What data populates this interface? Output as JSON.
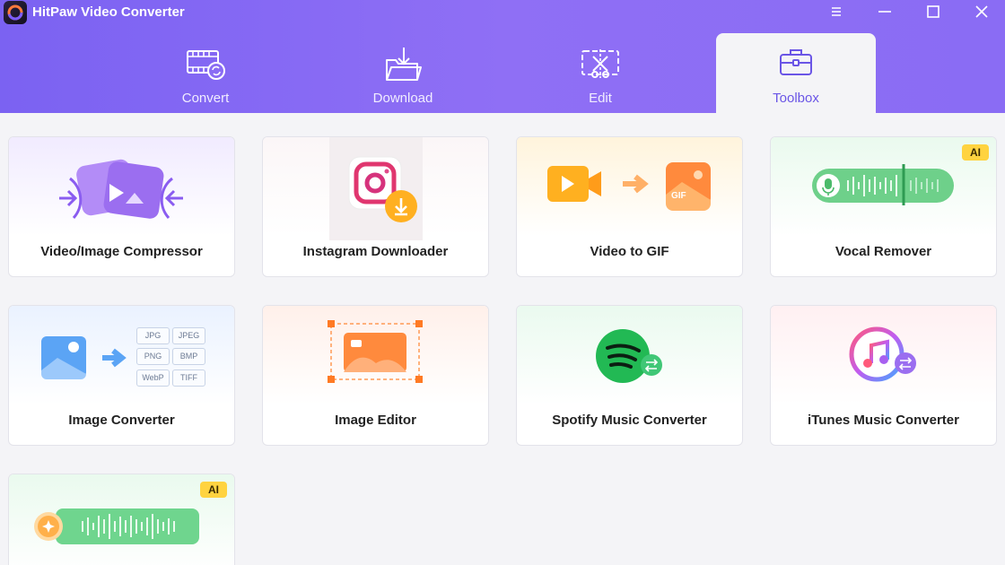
{
  "app": {
    "title": "HitPaw Video Converter"
  },
  "tabs": [
    {
      "label": "Convert",
      "icon": "convert-film-icon",
      "active": false
    },
    {
      "label": "Download",
      "icon": "download-folder-icon",
      "active": false
    },
    {
      "label": "Edit",
      "icon": "edit-scissors-icon",
      "active": false
    },
    {
      "label": "Toolbox",
      "icon": "toolbox-icon",
      "active": true
    }
  ],
  "tools": [
    {
      "label": "Video/Image Compressor",
      "icon": "compressor-icon",
      "ai": false
    },
    {
      "label": "Instagram Downloader",
      "icon": "instagram-icon",
      "ai": false
    },
    {
      "label": "Video to GIF",
      "icon": "video-to-gif-icon",
      "ai": false
    },
    {
      "label": "Vocal Remover",
      "icon": "vocal-remover-icon",
      "ai": true,
      "badge": "AI"
    },
    {
      "label": "Image Converter",
      "icon": "image-converter-icon",
      "ai": false,
      "formats": [
        "JPG",
        "JPEG",
        "PNG",
        "BMP",
        "WebP",
        "TIFF"
      ]
    },
    {
      "label": "Image Editor",
      "icon": "image-editor-icon",
      "ai": false
    },
    {
      "label": "Spotify Music Converter",
      "icon": "spotify-icon",
      "ai": false
    },
    {
      "label": "iTunes Music Converter",
      "icon": "itunes-icon",
      "ai": false
    },
    {
      "label": "",
      "icon": "ai-voice-icon",
      "ai": true,
      "badge": "AI"
    }
  ],
  "colors": {
    "header": "#8a6cf4",
    "active_tab_text": "#6a55e6",
    "ai_badge": "#ffd340"
  }
}
